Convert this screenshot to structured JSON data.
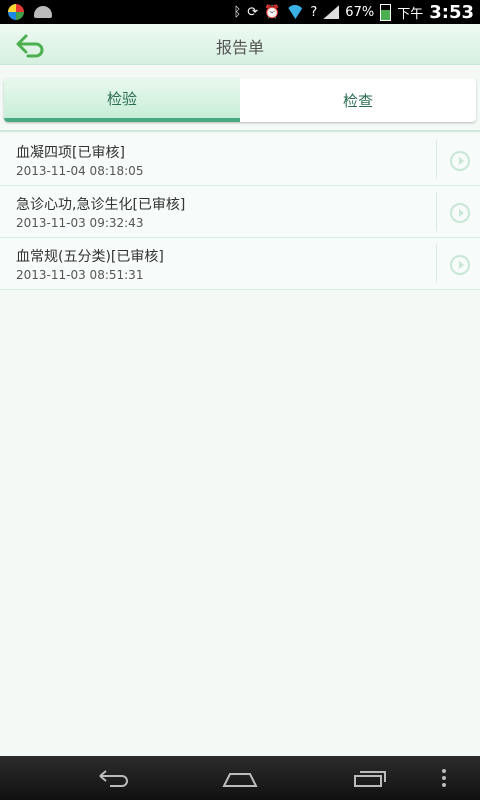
{
  "status_bar": {
    "battery_percent": "67%",
    "period": "下午",
    "time": "3:53"
  },
  "header": {
    "title": "报告单",
    "back_icon": "back-arrow-icon"
  },
  "tabs": [
    {
      "label": "检验",
      "active": true
    },
    {
      "label": "检查",
      "active": false
    }
  ],
  "reports": [
    {
      "title": "血凝四项[已审核]",
      "date": "2013-11-04 08:18:05"
    },
    {
      "title": "急诊心功,急诊生化[已审核]",
      "date": "2013-11-03 09:32:43"
    },
    {
      "title": "血常规(五分类)[已审核]",
      "date": "2013-11-03 08:51:31"
    }
  ],
  "colors": {
    "accent": "#47a882",
    "header_bg": "#d6f0e0",
    "list_bg": "#f7fbf9"
  }
}
